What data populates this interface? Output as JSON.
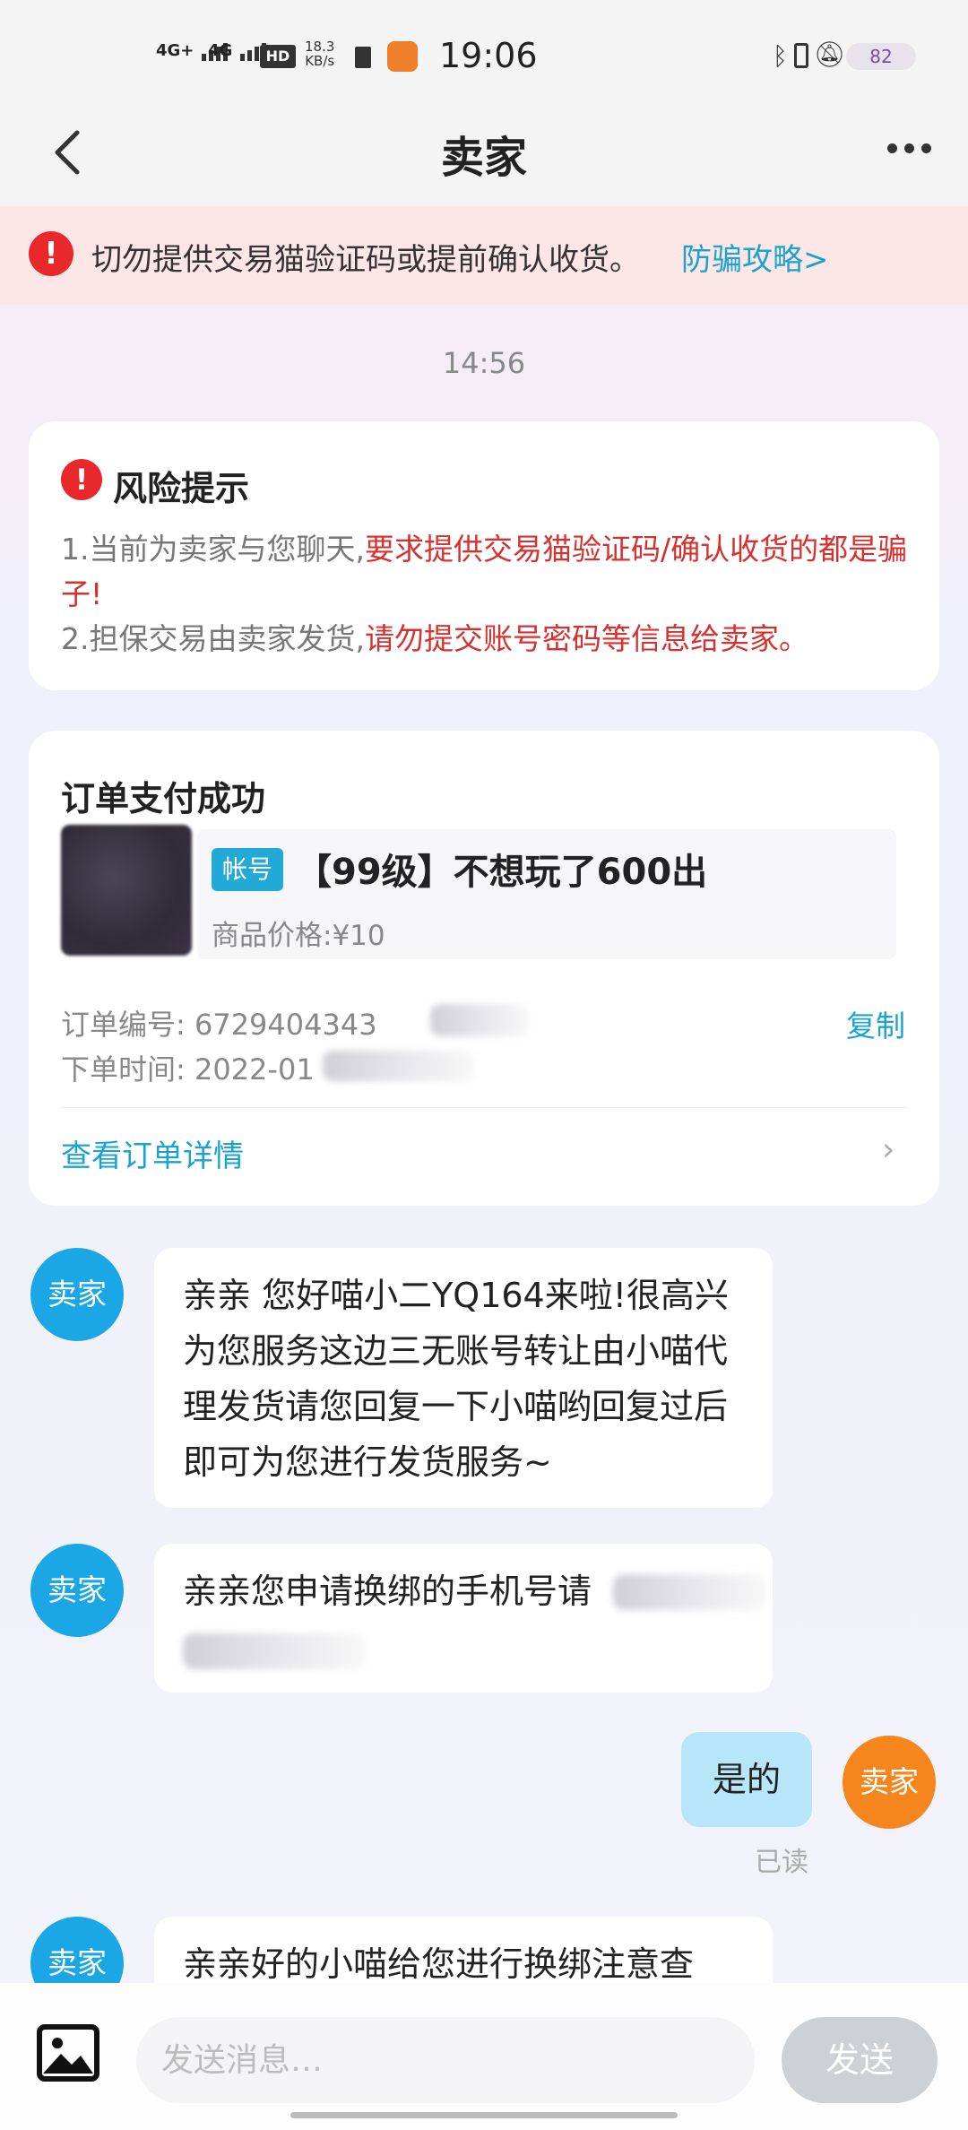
{
  "status_bar": {
    "net1": "4G+",
    "net2": "4G",
    "hd": "HD",
    "speed": "18.3",
    "speed_unit": "KB/s",
    "time": "19:06",
    "battery": "82"
  },
  "nav": {
    "title": "卖家"
  },
  "banner": {
    "text": "切勿提供交易猫验证码或提前确认收货。",
    "link": "防骗攻略>"
  },
  "timestamp": "14:56",
  "risk": {
    "icon_char": "!",
    "title": "风险提示",
    "line1_gray": "1.当前为卖家与您聊天,",
    "line1_red": "要求提供交易猫验证码/确认收货的都是骗子!",
    "line2_gray": "2.担保交易由卖家发货,",
    "line2_red": "请勿提交账号密码等信息给卖家。"
  },
  "order": {
    "title": "订单支付成功",
    "badge": "帐号",
    "product_name": "【99级】不想玩了600出",
    "price": "商品价格:¥10",
    "order_no_label": "订单编号:",
    "order_no_visible": "6729404343",
    "time_label": "下单时间:",
    "time_visible": "2022-01",
    "copy": "复制",
    "detail_link": "查看订单详情",
    "chevron": "›"
  },
  "messages": [
    {
      "sender": "卖家",
      "text": "亲亲 您好喵小二YQ164来啦!很高兴为您服务这边三无账号转让由小喵代理发货请您回复一下小喵哟回复过后即可为您进行发货服务~"
    },
    {
      "sender": "卖家",
      "text": "亲亲您申请换绑的手机号请"
    },
    {
      "sender": "卖家",
      "text": "是的",
      "status": "已读"
    },
    {
      "sender": "卖家",
      "text": "亲亲好的小喵给您进行换绑注意查"
    }
  ],
  "input": {
    "placeholder": "发送消息…",
    "send": "发送"
  },
  "icons": [
    "back-icon",
    "more-icon",
    "alert-icon",
    "image-icon",
    "bluetooth-icon",
    "mute-icon"
  ]
}
